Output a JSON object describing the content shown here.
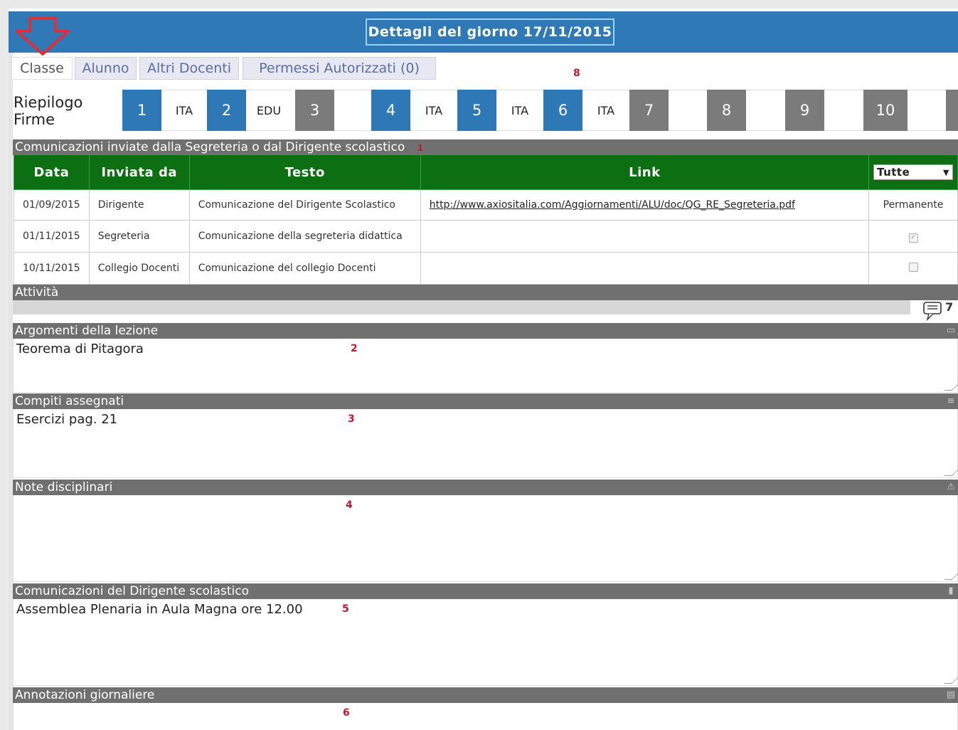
{
  "header": {
    "title": "Dettagli del giorno 17/11/2015"
  },
  "tabs": [
    {
      "label": "Classe"
    },
    {
      "label": "Alunno"
    },
    {
      "label": "Altri Docenti"
    },
    {
      "label": "Permessi Autorizzati (0)"
    }
  ],
  "annotations": [
    "8",
    "1",
    "7",
    "2",
    "3",
    "4",
    "5",
    "6"
  ],
  "riepilogo": {
    "label_line1": "Riepilogo",
    "label_line2": "Firme"
  },
  "hours": [
    {
      "num": "1",
      "subject": "ITA",
      "color": "#2e79b5"
    },
    {
      "num": "2",
      "subject": "EDU",
      "color": "#2e79b5"
    },
    {
      "num": "3",
      "subject": "",
      "color": "#7b7b7b"
    },
    {
      "num": "4",
      "subject": "ITA",
      "color": "#2e79b5"
    },
    {
      "num": "5",
      "subject": "ITA",
      "color": "#2e79b5"
    },
    {
      "num": "6",
      "subject": "ITA",
      "color": "#2e79b5"
    },
    {
      "num": "7",
      "subject": "",
      "color": "#7b7b7b"
    },
    {
      "num": "8",
      "subject": "",
      "color": "#7b7b7b"
    },
    {
      "num": "9",
      "subject": "",
      "color": "#7b7b7b"
    },
    {
      "num": "10",
      "subject": "",
      "color": "#7b7b7b"
    }
  ],
  "communications": {
    "section_title": "Comunicazioni inviate dalla Segreteria o dal Dirigente scolastico",
    "headers": {
      "data": "Data",
      "inviata_da": "Inviata da",
      "testo": "Testo",
      "link": "Link"
    },
    "filter": {
      "selected": "Tutte"
    },
    "rows": [
      {
        "data": "01/09/2015",
        "inviata_da": "Dirigente",
        "testo": "Comunicazione del Dirigente Scolastico",
        "link": "http://www.axiositalia.com/Aggiornamenti/ALU/doc/QG_RE_Segreteria.pdf",
        "status": "Permanente"
      },
      {
        "data": "01/11/2015",
        "inviata_da": "Segreteria",
        "testo": "Comunicazione della segreteria didattica",
        "link": "",
        "status": "checked"
      },
      {
        "data": "10/11/2015",
        "inviata_da": "Collegio Docenti",
        "testo": "Comunicazione del collegio Docenti",
        "link": "",
        "status": "unchecked"
      }
    ]
  },
  "sections": {
    "attivita": "Attività",
    "argomenti": {
      "title": "Argomenti della lezione",
      "value": "Teorema di Pitagora"
    },
    "compiti": {
      "title": "Compiti assegnati",
      "value": "Esercizi pag. 21"
    },
    "note": {
      "title": "Note disciplinari",
      "value": ""
    },
    "dirigente": {
      "title": "Comunicazioni del Dirigente scolastico",
      "value": "Assemblea Plenaria in Aula Magna ore 12.00"
    },
    "annotazioni": {
      "title": "Annotazioni giornaliere",
      "value": ""
    }
  }
}
